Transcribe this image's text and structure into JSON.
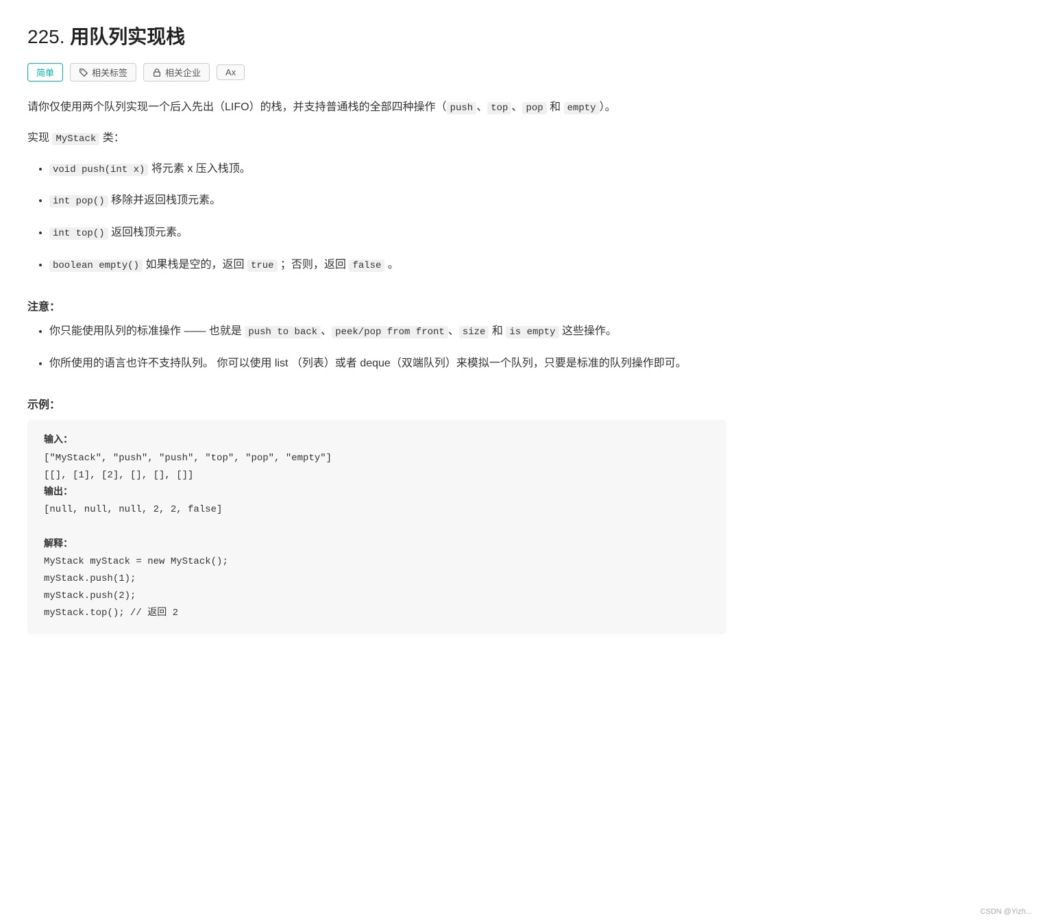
{
  "page": {
    "title_num": "225.",
    "title_text": "用队列实现栈",
    "tags": [
      {
        "label": "简单",
        "type": "easy"
      },
      {
        "label": "相关标签",
        "type": "normal",
        "icon": "tag"
      },
      {
        "label": "相关企业",
        "type": "normal",
        "icon": "lock"
      },
      {
        "label": "Ax",
        "type": "normal",
        "icon": "text"
      }
    ],
    "description": "请你仅使用两个队列实现一个后入先出（LIFO）的栈，并支持普通栈的全部四种操作（",
    "description_codes": [
      "push",
      "top",
      "pop",
      "empty"
    ],
    "description_suffix": "）。",
    "implement_label": "实现",
    "implement_class": "MyStack",
    "implement_suffix": "类：",
    "methods": [
      {
        "code": "void push(int x)",
        "desc": "将元素 x 压入栈顶。"
      },
      {
        "code": "int pop()",
        "desc": "移除并返回栈顶元素。"
      },
      {
        "code": "int top()",
        "desc": "返回栈顶元素。"
      },
      {
        "code": "boolean empty()",
        "desc_prefix": "如果栈是空的，返回",
        "desc_true": "true",
        "desc_mid": "；否则，返回",
        "desc_false": "false",
        "desc_suffix": "。"
      }
    ],
    "note_title": "注意：",
    "notes": [
      {
        "text_prefix": "你只能使用队列的标准操作 —— 也就是",
        "codes": [
          "push to back",
          "peek/pop from front",
          "size",
          "is empty"
        ],
        "text_suffix": "这些操作。"
      },
      {
        "text": "你所使用的语言也许不支持队列。 你可以使用 list （列表）或者 deque（双端队列）来模拟一个队列，只要是标准的队列操作即可。"
      }
    ],
    "example_title": "示例：",
    "example": {
      "input_label": "输入：",
      "input_line1": "[\"MyStack\", \"push\", \"push\", \"top\", \"pop\", \"empty\"]",
      "input_line2": "[[], [1], [2], [], [], []]",
      "output_label": "输出：",
      "output_line": "[null, null, null, 2, 2, false]",
      "explain_label": "解释：",
      "explain_lines": [
        "MyStack myStack = new MyStack();",
        "myStack.push(1);",
        "myStack.push(2);",
        "myStack.top(); // 返回 2"
      ]
    },
    "watermark": "CSDN @Yizh..."
  }
}
